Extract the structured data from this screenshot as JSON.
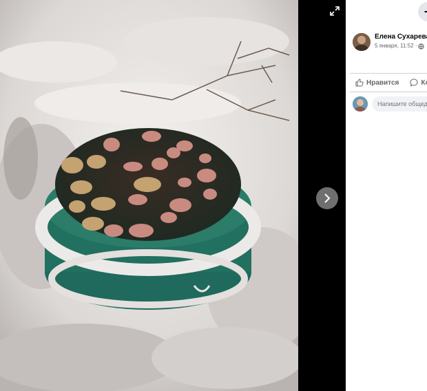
{
  "viewer": {
    "expand_icon": "expand-icon",
    "next_icon": "chevron-right-icon"
  },
  "panel": {
    "top_button_label": "+",
    "author_name": "Елена Сухарева",
    "post_date": "5 января, 11:52 ·",
    "privacy_icon": "globe-icon",
    "like_label": "Нравится",
    "comment_label": "Комментировать",
    "comment_placeholder": "Напишите общедоступный комментарий..."
  },
  "colors": {
    "panel_bg": "#ffffff",
    "viewer_bg": "#000000",
    "accent_text": "#65676b"
  }
}
